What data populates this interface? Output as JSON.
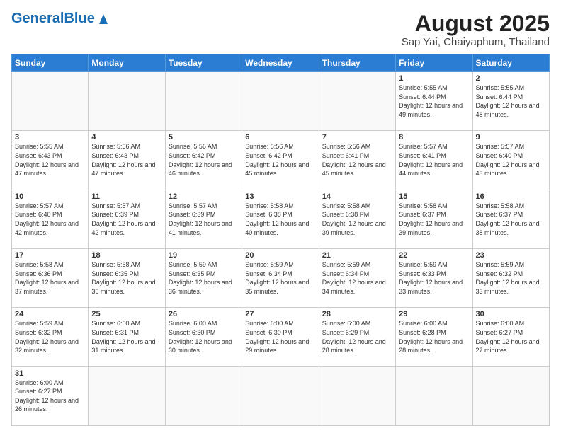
{
  "header": {
    "logo_text_normal": "General",
    "logo_text_blue": "Blue",
    "title": "August 2025",
    "subtitle": "Sap Yai, Chaiyaphum, Thailand"
  },
  "weekdays": [
    "Sunday",
    "Monday",
    "Tuesday",
    "Wednesday",
    "Thursday",
    "Friday",
    "Saturday"
  ],
  "weeks": [
    [
      {
        "day": "",
        "info": ""
      },
      {
        "day": "",
        "info": ""
      },
      {
        "day": "",
        "info": ""
      },
      {
        "day": "",
        "info": ""
      },
      {
        "day": "",
        "info": ""
      },
      {
        "day": "1",
        "info": "Sunrise: 5:55 AM\nSunset: 6:44 PM\nDaylight: 12 hours\nand 49 minutes."
      },
      {
        "day": "2",
        "info": "Sunrise: 5:55 AM\nSunset: 6:44 PM\nDaylight: 12 hours\nand 48 minutes."
      }
    ],
    [
      {
        "day": "3",
        "info": "Sunrise: 5:55 AM\nSunset: 6:43 PM\nDaylight: 12 hours\nand 47 minutes."
      },
      {
        "day": "4",
        "info": "Sunrise: 5:56 AM\nSunset: 6:43 PM\nDaylight: 12 hours\nand 47 minutes."
      },
      {
        "day": "5",
        "info": "Sunrise: 5:56 AM\nSunset: 6:42 PM\nDaylight: 12 hours\nand 46 minutes."
      },
      {
        "day": "6",
        "info": "Sunrise: 5:56 AM\nSunset: 6:42 PM\nDaylight: 12 hours\nand 45 minutes."
      },
      {
        "day": "7",
        "info": "Sunrise: 5:56 AM\nSunset: 6:41 PM\nDaylight: 12 hours\nand 45 minutes."
      },
      {
        "day": "8",
        "info": "Sunrise: 5:57 AM\nSunset: 6:41 PM\nDaylight: 12 hours\nand 44 minutes."
      },
      {
        "day": "9",
        "info": "Sunrise: 5:57 AM\nSunset: 6:40 PM\nDaylight: 12 hours\nand 43 minutes."
      }
    ],
    [
      {
        "day": "10",
        "info": "Sunrise: 5:57 AM\nSunset: 6:40 PM\nDaylight: 12 hours\nand 42 minutes."
      },
      {
        "day": "11",
        "info": "Sunrise: 5:57 AM\nSunset: 6:39 PM\nDaylight: 12 hours\nand 42 minutes."
      },
      {
        "day": "12",
        "info": "Sunrise: 5:57 AM\nSunset: 6:39 PM\nDaylight: 12 hours\nand 41 minutes."
      },
      {
        "day": "13",
        "info": "Sunrise: 5:58 AM\nSunset: 6:38 PM\nDaylight: 12 hours\nand 40 minutes."
      },
      {
        "day": "14",
        "info": "Sunrise: 5:58 AM\nSunset: 6:38 PM\nDaylight: 12 hours\nand 39 minutes."
      },
      {
        "day": "15",
        "info": "Sunrise: 5:58 AM\nSunset: 6:37 PM\nDaylight: 12 hours\nand 39 minutes."
      },
      {
        "day": "16",
        "info": "Sunrise: 5:58 AM\nSunset: 6:37 PM\nDaylight: 12 hours\nand 38 minutes."
      }
    ],
    [
      {
        "day": "17",
        "info": "Sunrise: 5:58 AM\nSunset: 6:36 PM\nDaylight: 12 hours\nand 37 minutes."
      },
      {
        "day": "18",
        "info": "Sunrise: 5:58 AM\nSunset: 6:35 PM\nDaylight: 12 hours\nand 36 minutes."
      },
      {
        "day": "19",
        "info": "Sunrise: 5:59 AM\nSunset: 6:35 PM\nDaylight: 12 hours\nand 36 minutes."
      },
      {
        "day": "20",
        "info": "Sunrise: 5:59 AM\nSunset: 6:34 PM\nDaylight: 12 hours\nand 35 minutes."
      },
      {
        "day": "21",
        "info": "Sunrise: 5:59 AM\nSunset: 6:34 PM\nDaylight: 12 hours\nand 34 minutes."
      },
      {
        "day": "22",
        "info": "Sunrise: 5:59 AM\nSunset: 6:33 PM\nDaylight: 12 hours\nand 33 minutes."
      },
      {
        "day": "23",
        "info": "Sunrise: 5:59 AM\nSunset: 6:32 PM\nDaylight: 12 hours\nand 33 minutes."
      }
    ],
    [
      {
        "day": "24",
        "info": "Sunrise: 5:59 AM\nSunset: 6:32 PM\nDaylight: 12 hours\nand 32 minutes."
      },
      {
        "day": "25",
        "info": "Sunrise: 6:00 AM\nSunset: 6:31 PM\nDaylight: 12 hours\nand 31 minutes."
      },
      {
        "day": "26",
        "info": "Sunrise: 6:00 AM\nSunset: 6:30 PM\nDaylight: 12 hours\nand 30 minutes."
      },
      {
        "day": "27",
        "info": "Sunrise: 6:00 AM\nSunset: 6:30 PM\nDaylight: 12 hours\nand 29 minutes."
      },
      {
        "day": "28",
        "info": "Sunrise: 6:00 AM\nSunset: 6:29 PM\nDaylight: 12 hours\nand 28 minutes."
      },
      {
        "day": "29",
        "info": "Sunrise: 6:00 AM\nSunset: 6:28 PM\nDaylight: 12 hours\nand 28 minutes."
      },
      {
        "day": "30",
        "info": "Sunrise: 6:00 AM\nSunset: 6:27 PM\nDaylight: 12 hours\nand 27 minutes."
      }
    ],
    [
      {
        "day": "31",
        "info": "Sunrise: 6:00 AM\nSunset: 6:27 PM\nDaylight: 12 hours\nand 26 minutes."
      },
      {
        "day": "",
        "info": ""
      },
      {
        "day": "",
        "info": ""
      },
      {
        "day": "",
        "info": ""
      },
      {
        "day": "",
        "info": ""
      },
      {
        "day": "",
        "info": ""
      },
      {
        "day": "",
        "info": ""
      }
    ]
  ]
}
